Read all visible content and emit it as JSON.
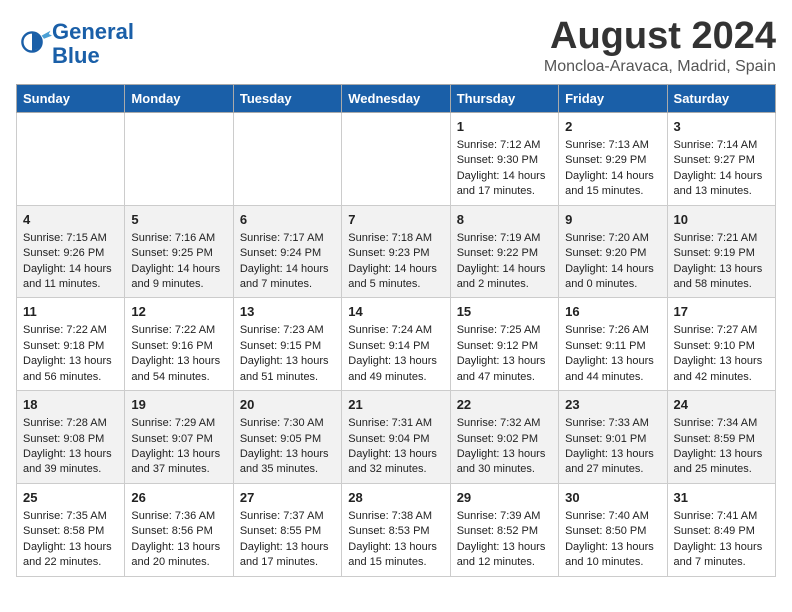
{
  "header": {
    "logo_line1": "General",
    "logo_line2": "Blue",
    "title": "August 2024",
    "location": "Moncloa-Aravaca, Madrid, Spain"
  },
  "weekdays": [
    "Sunday",
    "Monday",
    "Tuesday",
    "Wednesday",
    "Thursday",
    "Friday",
    "Saturday"
  ],
  "weeks": [
    [
      {
        "day": "",
        "content": ""
      },
      {
        "day": "",
        "content": ""
      },
      {
        "day": "",
        "content": ""
      },
      {
        "day": "",
        "content": ""
      },
      {
        "day": "1",
        "content": "Sunrise: 7:12 AM\nSunset: 9:30 PM\nDaylight: 14 hours and 17 minutes."
      },
      {
        "day": "2",
        "content": "Sunrise: 7:13 AM\nSunset: 9:29 PM\nDaylight: 14 hours and 15 minutes."
      },
      {
        "day": "3",
        "content": "Sunrise: 7:14 AM\nSunset: 9:27 PM\nDaylight: 14 hours and 13 minutes."
      }
    ],
    [
      {
        "day": "4",
        "content": "Sunrise: 7:15 AM\nSunset: 9:26 PM\nDaylight: 14 hours and 11 minutes."
      },
      {
        "day": "5",
        "content": "Sunrise: 7:16 AM\nSunset: 9:25 PM\nDaylight: 14 hours and 9 minutes."
      },
      {
        "day": "6",
        "content": "Sunrise: 7:17 AM\nSunset: 9:24 PM\nDaylight: 14 hours and 7 minutes."
      },
      {
        "day": "7",
        "content": "Sunrise: 7:18 AM\nSunset: 9:23 PM\nDaylight: 14 hours and 5 minutes."
      },
      {
        "day": "8",
        "content": "Sunrise: 7:19 AM\nSunset: 9:22 PM\nDaylight: 14 hours and 2 minutes."
      },
      {
        "day": "9",
        "content": "Sunrise: 7:20 AM\nSunset: 9:20 PM\nDaylight: 14 hours and 0 minutes."
      },
      {
        "day": "10",
        "content": "Sunrise: 7:21 AM\nSunset: 9:19 PM\nDaylight: 13 hours and 58 minutes."
      }
    ],
    [
      {
        "day": "11",
        "content": "Sunrise: 7:22 AM\nSunset: 9:18 PM\nDaylight: 13 hours and 56 minutes."
      },
      {
        "day": "12",
        "content": "Sunrise: 7:22 AM\nSunset: 9:16 PM\nDaylight: 13 hours and 54 minutes."
      },
      {
        "day": "13",
        "content": "Sunrise: 7:23 AM\nSunset: 9:15 PM\nDaylight: 13 hours and 51 minutes."
      },
      {
        "day": "14",
        "content": "Sunrise: 7:24 AM\nSunset: 9:14 PM\nDaylight: 13 hours and 49 minutes."
      },
      {
        "day": "15",
        "content": "Sunrise: 7:25 AM\nSunset: 9:12 PM\nDaylight: 13 hours and 47 minutes."
      },
      {
        "day": "16",
        "content": "Sunrise: 7:26 AM\nSunset: 9:11 PM\nDaylight: 13 hours and 44 minutes."
      },
      {
        "day": "17",
        "content": "Sunrise: 7:27 AM\nSunset: 9:10 PM\nDaylight: 13 hours and 42 minutes."
      }
    ],
    [
      {
        "day": "18",
        "content": "Sunrise: 7:28 AM\nSunset: 9:08 PM\nDaylight: 13 hours and 39 minutes."
      },
      {
        "day": "19",
        "content": "Sunrise: 7:29 AM\nSunset: 9:07 PM\nDaylight: 13 hours and 37 minutes."
      },
      {
        "day": "20",
        "content": "Sunrise: 7:30 AM\nSunset: 9:05 PM\nDaylight: 13 hours and 35 minutes."
      },
      {
        "day": "21",
        "content": "Sunrise: 7:31 AM\nSunset: 9:04 PM\nDaylight: 13 hours and 32 minutes."
      },
      {
        "day": "22",
        "content": "Sunrise: 7:32 AM\nSunset: 9:02 PM\nDaylight: 13 hours and 30 minutes."
      },
      {
        "day": "23",
        "content": "Sunrise: 7:33 AM\nSunset: 9:01 PM\nDaylight: 13 hours and 27 minutes."
      },
      {
        "day": "24",
        "content": "Sunrise: 7:34 AM\nSunset: 8:59 PM\nDaylight: 13 hours and 25 minutes."
      }
    ],
    [
      {
        "day": "25",
        "content": "Sunrise: 7:35 AM\nSunset: 8:58 PM\nDaylight: 13 hours and 22 minutes."
      },
      {
        "day": "26",
        "content": "Sunrise: 7:36 AM\nSunset: 8:56 PM\nDaylight: 13 hours and 20 minutes."
      },
      {
        "day": "27",
        "content": "Sunrise: 7:37 AM\nSunset: 8:55 PM\nDaylight: 13 hours and 17 minutes."
      },
      {
        "day": "28",
        "content": "Sunrise: 7:38 AM\nSunset: 8:53 PM\nDaylight: 13 hours and 15 minutes."
      },
      {
        "day": "29",
        "content": "Sunrise: 7:39 AM\nSunset: 8:52 PM\nDaylight: 13 hours and 12 minutes."
      },
      {
        "day": "30",
        "content": "Sunrise: 7:40 AM\nSunset: 8:50 PM\nDaylight: 13 hours and 10 minutes."
      },
      {
        "day": "31",
        "content": "Sunrise: 7:41 AM\nSunset: 8:49 PM\nDaylight: 13 hours and 7 minutes."
      }
    ]
  ]
}
